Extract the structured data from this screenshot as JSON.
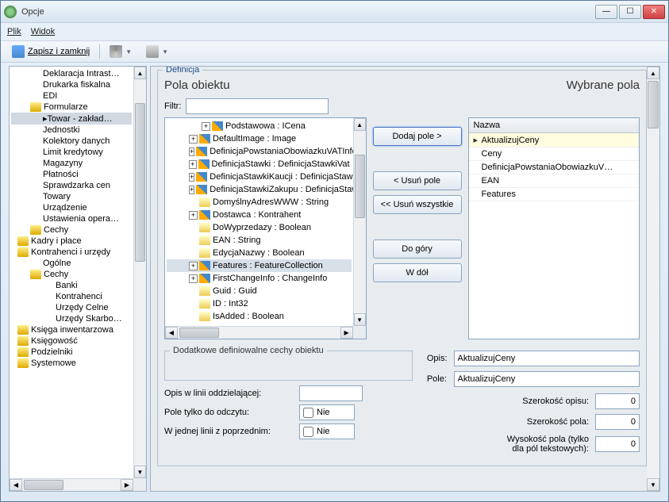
{
  "window": {
    "title": "Opcje"
  },
  "menu": {
    "plik": "Plik",
    "widok": "Widok"
  },
  "toolbar": {
    "save_close": "Zapisz i zamknij"
  },
  "tree_left": [
    {
      "l": "Deklaracja Intrast…",
      "i": 40
    },
    {
      "l": "Drukarka fiskalna",
      "i": 40
    },
    {
      "l": "EDI",
      "i": 40
    },
    {
      "l": "Formularze",
      "i": 24,
      "f": true
    },
    {
      "l": "Towar - zakład…",
      "i": 40,
      "sel": true,
      "bullet": true
    },
    {
      "l": "Jednostki",
      "i": 40
    },
    {
      "l": "Kolektory danych",
      "i": 40
    },
    {
      "l": "Limit kredytowy",
      "i": 40
    },
    {
      "l": "Magazyny",
      "i": 40
    },
    {
      "l": "Płatności",
      "i": 40
    },
    {
      "l": "Sprawdzarka cen",
      "i": 40
    },
    {
      "l": "Towary",
      "i": 40
    },
    {
      "l": "Urządzenie",
      "i": 40
    },
    {
      "l": "Ustawienia opera…",
      "i": 40
    },
    {
      "l": "Cechy",
      "i": 24,
      "f": true
    },
    {
      "l": "Kadry i płace",
      "i": 8,
      "f": true
    },
    {
      "l": "Kontrahenci i urzędy",
      "i": 8,
      "f": true
    },
    {
      "l": "Ogólne",
      "i": 40
    },
    {
      "l": "Cechy",
      "i": 24,
      "f": true
    },
    {
      "l": "Banki",
      "i": 56
    },
    {
      "l": "Kontrahenci",
      "i": 56
    },
    {
      "l": "Urzędy Celne",
      "i": 56
    },
    {
      "l": "Urzędy Skarbo…",
      "i": 56
    },
    {
      "l": "Księga inwentarzowa",
      "i": 8,
      "f": true
    },
    {
      "l": "Księgowość",
      "i": 8,
      "f": true
    },
    {
      "l": "Podzielniki",
      "i": 8,
      "f": true
    },
    {
      "l": "Systemowe",
      "i": 8,
      "f": true
    }
  ],
  "def": {
    "group_title": "Definicja",
    "h_left": "Pola obiektu",
    "h_right": "Wybrane pola",
    "filtr_label": "Filtr:",
    "filtr_value": "",
    "fields": [
      {
        "l": "Podstawowa : ICena",
        "i": 44,
        "exp": "+",
        "ico": "d"
      },
      {
        "l": "DefaultImage : Image",
        "i": 28,
        "exp": "+",
        "ico": "d"
      },
      {
        "l": "DefinicjaPowstaniaObowiazkuVATInfo",
        "i": 28,
        "exp": "+",
        "ico": "d"
      },
      {
        "l": "DefinicjaStawki : DefinicjaStawkiVat",
        "i": 28,
        "exp": "+",
        "ico": "d"
      },
      {
        "l": "DefinicjaStawkiKaucji : DefinicjaStawki",
        "i": 28,
        "exp": "+",
        "ico": "d"
      },
      {
        "l": "DefinicjaStawkiZakupu : DefinicjaStaw…",
        "i": 28,
        "exp": "+",
        "ico": "d"
      },
      {
        "l": "DomyślnyAdresWWW : String",
        "i": 28,
        "exp": "",
        "ico": "y"
      },
      {
        "l": "Dostawca : Kontrahent",
        "i": 28,
        "exp": "+",
        "ico": "d"
      },
      {
        "l": "DoWyprzedazy : Boolean",
        "i": 28,
        "exp": "",
        "ico": "y"
      },
      {
        "l": "EAN : String",
        "i": 28,
        "exp": "",
        "ico": "y"
      },
      {
        "l": "EdycjaNazwy : Boolean",
        "i": 28,
        "exp": "",
        "ico": "y"
      },
      {
        "l": "Features : FeatureCollection",
        "i": 28,
        "exp": "+",
        "ico": "d",
        "sel": true
      },
      {
        "l": "FirstChangeInfo : ChangeInfo",
        "i": 28,
        "exp": "+",
        "ico": "d"
      },
      {
        "l": "Guid : Guid",
        "i": 28,
        "exp": "",
        "ico": "y"
      },
      {
        "l": "ID : Int32",
        "i": 28,
        "exp": "",
        "ico": "y"
      },
      {
        "l": "IsAdded : Boolean",
        "i": 28,
        "exp": "",
        "ico": "y"
      }
    ],
    "buttons": {
      "add": "Dodaj pole >",
      "remove": "< Usuń pole",
      "remove_all": "<< Usuń wszystkie",
      "up": "Do góry",
      "down": "W dół"
    },
    "grid_header": "Nazwa",
    "selected": [
      {
        "l": "AktualizujCeny",
        "sel": true
      },
      {
        "l": "Ceny"
      },
      {
        "l": "DefinicjaPowstaniaObowiazkuV…"
      },
      {
        "l": "EAN"
      },
      {
        "l": "Features"
      }
    ],
    "extra_group": "Dodatkowe definiowalne cechy obiektu",
    "opis_linii_label": "Opis w linii oddzielającej:",
    "opis_linii_value": "",
    "readonly_label": "Pole tylko do odczytu:",
    "readonly_value": "Nie",
    "sameline_label": "W jednej linii z poprzednim:",
    "sameline_value": "Nie",
    "opis_label": "Opis:",
    "opis_value": "AktualizujCeny",
    "pole_label": "Pole:",
    "pole_value": "AktualizujCeny",
    "szer_opisu_label": "Szerokość opisu:",
    "szer_opisu_value": "0",
    "szer_pola_label": "Szerokość pola:",
    "szer_pola_value": "0",
    "wys_pola_label": "Wysokość pola (tylko dla pól tekstowych):",
    "wys_pola_value": "0"
  }
}
